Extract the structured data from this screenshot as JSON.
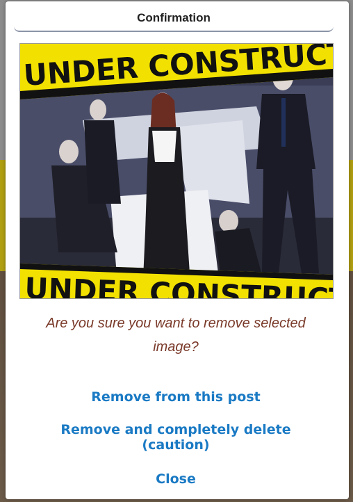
{
  "dialog": {
    "title": "Confirmation",
    "question": "Are you sure you want to remove selected image?",
    "actions": {
      "remove_from_post": "Remove from this post",
      "delete_completely": "Remove and completely delete (caution)",
      "close": "Close"
    }
  },
  "image": {
    "tape_text_top": "UNDER CONSTRUCTION",
    "tape_text_bottom": "UNDER CONSTRUCTION"
  },
  "colors": {
    "tape_yellow": "#f2e100",
    "link_blue": "#1a7ac4",
    "question_text": "#7a3a2a"
  }
}
